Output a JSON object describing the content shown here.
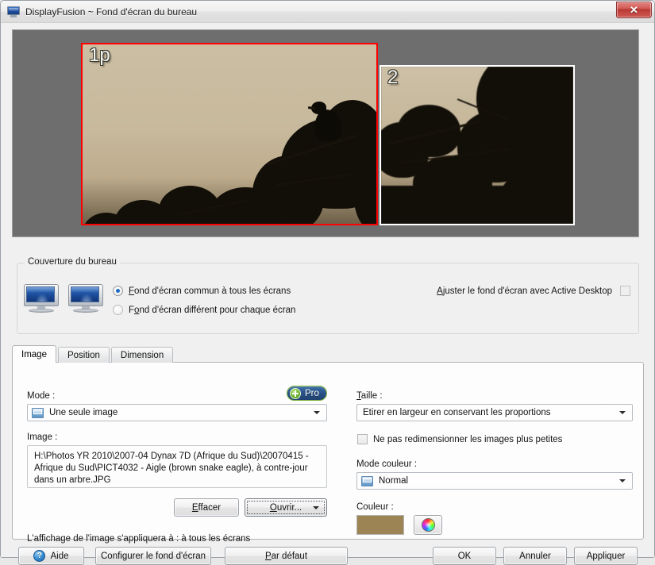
{
  "window": {
    "title": "DisplayFusion ~ Fond d'écran du bureau",
    "icon": "monitor-icon",
    "close_label": "✕"
  },
  "preview": {
    "monitors": [
      {
        "label": "1p",
        "selected": true
      },
      {
        "label": "2",
        "selected": false
      }
    ]
  },
  "coverage": {
    "group_title": "Couverture du bureau",
    "icon": "dual-monitor-icon",
    "options": [
      {
        "label_pre": "",
        "accel": "F",
        "label_post": "ond d'écran commun à tous les écrans",
        "selected": true
      },
      {
        "label_pre": "F",
        "accel": "o",
        "label_post": "nd d'écran différent pour chaque écran",
        "selected": false
      }
    ],
    "active_desktop": {
      "label_pre": "A",
      "accel": "j",
      "label_post": "uster le fond d'écran avec Active Desktop",
      "checked": false
    }
  },
  "tabs": [
    {
      "label": "Image",
      "active": true
    },
    {
      "label": "Position",
      "active": false
    },
    {
      "label": "Dimension",
      "active": false
    }
  ],
  "image_tab": {
    "mode_label": "Mode :",
    "mode_value": "Une seule image",
    "mode_icon": "screen-icon",
    "pro_badge": "Pro",
    "pro_icon": "green-plus-icon",
    "image_label": "Image :",
    "image_path": "H:\\Photos YR 2010\\2007-04 Dynax 7D (Afrique du Sud)\\20070415 - Afrique du Sud\\PICT4032 - Aigle (brown snake eagle), à contre-jour dans un arbre.JPG",
    "clear_button": {
      "pre": "",
      "accel": "E",
      "post": "ffacer"
    },
    "open_button": {
      "pre": "",
      "accel": "O",
      "post": "uvrir...",
      "has_dropdown": true,
      "focused": true
    },
    "size_label": {
      "pre": "",
      "accel": "T",
      "post": "aille :"
    },
    "size_value": "Étirer en largeur en conservant les proportions",
    "no_resize": {
      "label": "Ne pas redimensionner les images plus petites",
      "checked": false
    },
    "color_mode_label": "Mode couleur :",
    "color_mode_value": "Normal",
    "color_mode_icon": "screen-icon",
    "color_label": "Couleur :",
    "color_value": "#9d8454",
    "color_picker_icon": "color-wheel-icon",
    "status_note": "L'affichage de l'image s'appliquera à : à tous les écrans"
  },
  "footer": {
    "help": {
      "pre": "",
      "accel": "",
      "post": "Aide",
      "icon": "help-icon"
    },
    "configure": {
      "pre": "Confi",
      "accel": "g",
      "post": "urer le fond d'écran"
    },
    "default": {
      "pre": "",
      "accel": "P",
      "post": "ar défaut"
    },
    "ok": "OK",
    "cancel": "Annuler",
    "apply": "Appliquer"
  }
}
